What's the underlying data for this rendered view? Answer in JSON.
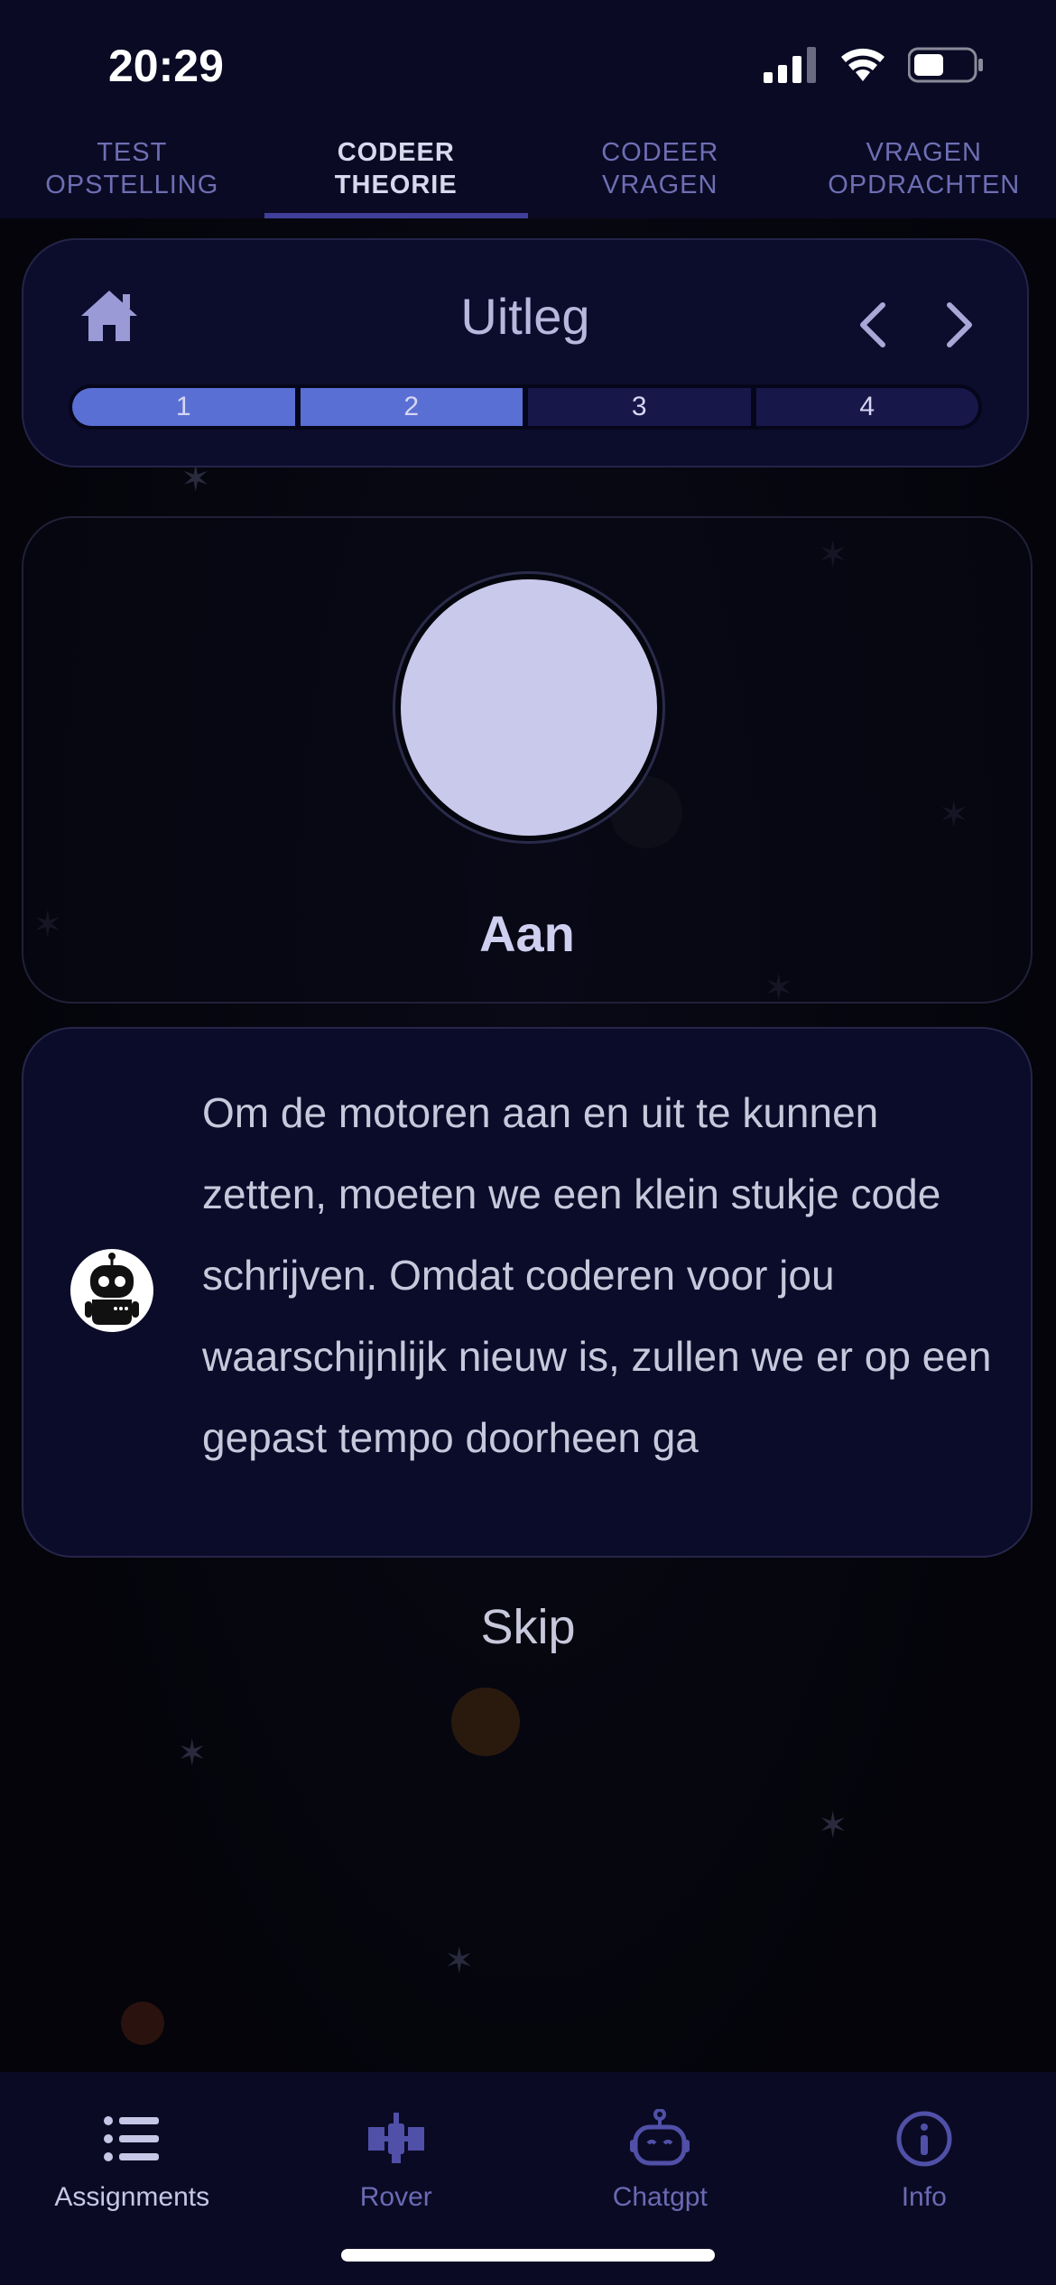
{
  "status_bar": {
    "time": "20:29"
  },
  "top_tabs": [
    {
      "label": "TEST\nOPSTELLING",
      "active": false
    },
    {
      "label": "CODEER\nTHEORIE",
      "active": true
    },
    {
      "label": "CODEER\nVRAGEN",
      "active": false
    },
    {
      "label": "VRAGEN\nOPDRACHTEN",
      "active": false
    }
  ],
  "header": {
    "title": "Uitleg",
    "progress_segments": [
      "1",
      "2",
      "3",
      "4"
    ],
    "progress_completed": 2
  },
  "state_card": {
    "label": "Aan"
  },
  "message": {
    "text": "Om de motoren aan en uit te kunnen zetten, moeten we een klein stukje code schrijven. Omdat coderen voor jou waarschijnlijk nieuw is, zullen we er op een gepast tempo doorheen ga"
  },
  "skip_label": "Skip",
  "bottom_nav": [
    {
      "label": "Assignments",
      "icon": "list-icon",
      "active": true
    },
    {
      "label": "Rover",
      "icon": "satellite-icon",
      "active": false
    },
    {
      "label": "Chatgpt",
      "icon": "robot-icon",
      "active": false
    },
    {
      "label": "Info",
      "icon": "info-icon",
      "active": false
    }
  ],
  "colors": {
    "background": "#05050d",
    "bar": "#0a0a24",
    "accent": "#5a6fd4",
    "inactive": "#6a6ab4"
  }
}
